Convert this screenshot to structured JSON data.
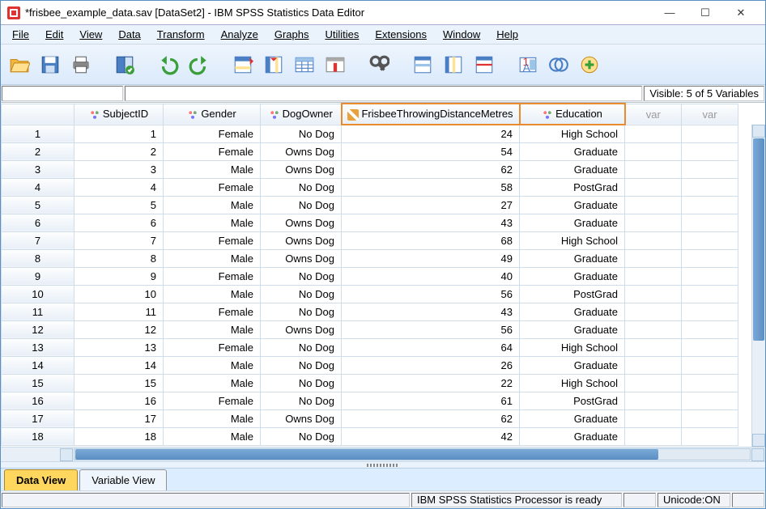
{
  "title": "*frisbee_example_data.sav [DataSet2] - IBM SPSS Statistics Data Editor",
  "window_buttons": {
    "min": "—",
    "max": "☐",
    "close": "✕"
  },
  "menu": [
    "File",
    "Edit",
    "View",
    "Data",
    "Transform",
    "Analyze",
    "Graphs",
    "Utilities",
    "Extensions",
    "Window",
    "Help"
  ],
  "toolbar_icons": [
    "open",
    "save",
    "print",
    "recent",
    "undo",
    "redo",
    "goto-case",
    "goto-var",
    "variables",
    "run",
    "find",
    "insert-case",
    "insert-var",
    "split",
    "weight",
    "select",
    "value-labels",
    "sets",
    "customize"
  ],
  "visible_text": "Visible: 5 of 5 Variables",
  "columns": [
    {
      "name": "SubjectID",
      "type": "nom",
      "highlight": false
    },
    {
      "name": "Gender",
      "type": "nom",
      "highlight": false
    },
    {
      "name": "DogOwner",
      "type": "nom",
      "highlight": false
    },
    {
      "name": "FrisbeeThrowingDistanceMetres",
      "type": "scale",
      "highlight": true
    },
    {
      "name": "Education",
      "type": "nom",
      "highlight": true
    }
  ],
  "empty_col_label": "var",
  "rows": [
    {
      "n": 1,
      "SubjectID": "1",
      "Gender": "Female",
      "DogOwner": "No Dog",
      "Frisbee": "24",
      "Education": "High School"
    },
    {
      "n": 2,
      "SubjectID": "2",
      "Gender": "Female",
      "DogOwner": "Owns Dog",
      "Frisbee": "54",
      "Education": "Graduate"
    },
    {
      "n": 3,
      "SubjectID": "3",
      "Gender": "Male",
      "DogOwner": "Owns Dog",
      "Frisbee": "62",
      "Education": "Graduate"
    },
    {
      "n": 4,
      "SubjectID": "4",
      "Gender": "Female",
      "DogOwner": "No Dog",
      "Frisbee": "58",
      "Education": "PostGrad"
    },
    {
      "n": 5,
      "SubjectID": "5",
      "Gender": "Male",
      "DogOwner": "No Dog",
      "Frisbee": "27",
      "Education": "Graduate"
    },
    {
      "n": 6,
      "SubjectID": "6",
      "Gender": "Male",
      "DogOwner": "Owns Dog",
      "Frisbee": "43",
      "Education": "Graduate"
    },
    {
      "n": 7,
      "SubjectID": "7",
      "Gender": "Female",
      "DogOwner": "Owns Dog",
      "Frisbee": "68",
      "Education": "High School"
    },
    {
      "n": 8,
      "SubjectID": "8",
      "Gender": "Male",
      "DogOwner": "Owns Dog",
      "Frisbee": "49",
      "Education": "Graduate"
    },
    {
      "n": 9,
      "SubjectID": "9",
      "Gender": "Female",
      "DogOwner": "No Dog",
      "Frisbee": "40",
      "Education": "Graduate"
    },
    {
      "n": 10,
      "SubjectID": "10",
      "Gender": "Male",
      "DogOwner": "No Dog",
      "Frisbee": "56",
      "Education": "PostGrad"
    },
    {
      "n": 11,
      "SubjectID": "11",
      "Gender": "Female",
      "DogOwner": "No Dog",
      "Frisbee": "43",
      "Education": "Graduate"
    },
    {
      "n": 12,
      "SubjectID": "12",
      "Gender": "Male",
      "DogOwner": "Owns Dog",
      "Frisbee": "56",
      "Education": "Graduate"
    },
    {
      "n": 13,
      "SubjectID": "13",
      "Gender": "Female",
      "DogOwner": "No Dog",
      "Frisbee": "64",
      "Education": "High School"
    },
    {
      "n": 14,
      "SubjectID": "14",
      "Gender": "Male",
      "DogOwner": "No Dog",
      "Frisbee": "26",
      "Education": "Graduate"
    },
    {
      "n": 15,
      "SubjectID": "15",
      "Gender": "Male",
      "DogOwner": "No Dog",
      "Frisbee": "22",
      "Education": "High School"
    },
    {
      "n": 16,
      "SubjectID": "16",
      "Gender": "Female",
      "DogOwner": "No Dog",
      "Frisbee": "61",
      "Education": "PostGrad"
    },
    {
      "n": 17,
      "SubjectID": "17",
      "Gender": "Male",
      "DogOwner": "Owns Dog",
      "Frisbee": "62",
      "Education": "Graduate"
    },
    {
      "n": 18,
      "SubjectID": "18",
      "Gender": "Male",
      "DogOwner": "No Dog",
      "Frisbee": "42",
      "Education": "Graduate"
    }
  ],
  "tabs": {
    "data_view": "Data View",
    "variable_view": "Variable View"
  },
  "status": {
    "processor": "IBM SPSS Statistics Processor is ready",
    "unicode": "Unicode:ON"
  }
}
